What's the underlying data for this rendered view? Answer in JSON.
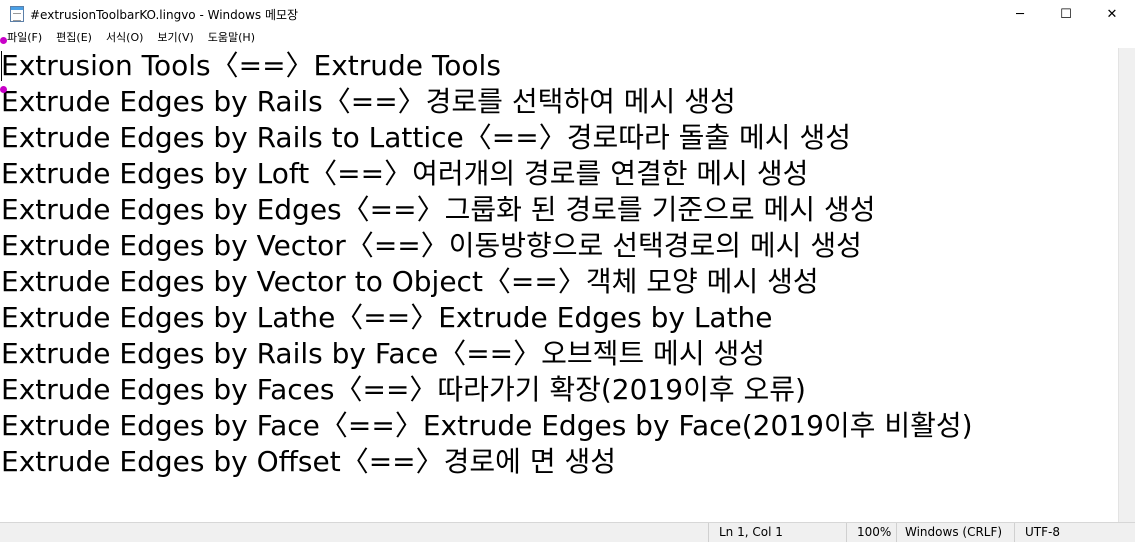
{
  "window": {
    "title": "#extrusionToolbarKO.lingvo - Windows 메모장",
    "minimize_glyph": "─",
    "maximize_glyph": "☐",
    "close_glyph": "✕"
  },
  "menu": [
    {
      "label": "파일(F)"
    },
    {
      "label": "편집(E)"
    },
    {
      "label": "서식(O)"
    },
    {
      "label": "보기(V)"
    },
    {
      "label": "도움말(H)"
    }
  ],
  "lines": [
    "Extrusion Tools〈==〉Extrude Tools",
    "Extrude Edges by Rails〈==〉경로를 선택하여 메시 생성",
    "Extrude Edges by Rails to Lattice〈==〉경로따라 돌출 메시 생성",
    "Extrude Edges by Loft〈==〉여러개의 경로를 연결한 메시 생성",
    "Extrude Edges by Edges〈==〉그룹화 된 경로를 기준으로 메시 생성",
    "Extrude Edges by Vector〈==〉이동방향으로 선택경로의 메시 생성",
    "Extrude Edges by Vector to Object〈==〉객체 모양 메시 생성",
    "Extrude Edges by Lathe〈==〉Extrude Edges by Lathe",
    "Extrude Edges by Rails by Face〈==〉오브젝트 메시 생성",
    "Extrude Edges by Faces〈==〉따라가기 확장(2019이후 오류)",
    "Extrude Edges by Face〈==〉Extrude Edges by Face(2019이후 비활성)",
    "Extrude Edges by Offset〈==〉경로에 면 생성"
  ],
  "status": {
    "position": "Ln 1, Col 1",
    "zoom": "100%",
    "line_ending": "Windows (CRLF)",
    "encoding": "UTF-8"
  },
  "colors": {
    "marker": "#c800c8"
  }
}
